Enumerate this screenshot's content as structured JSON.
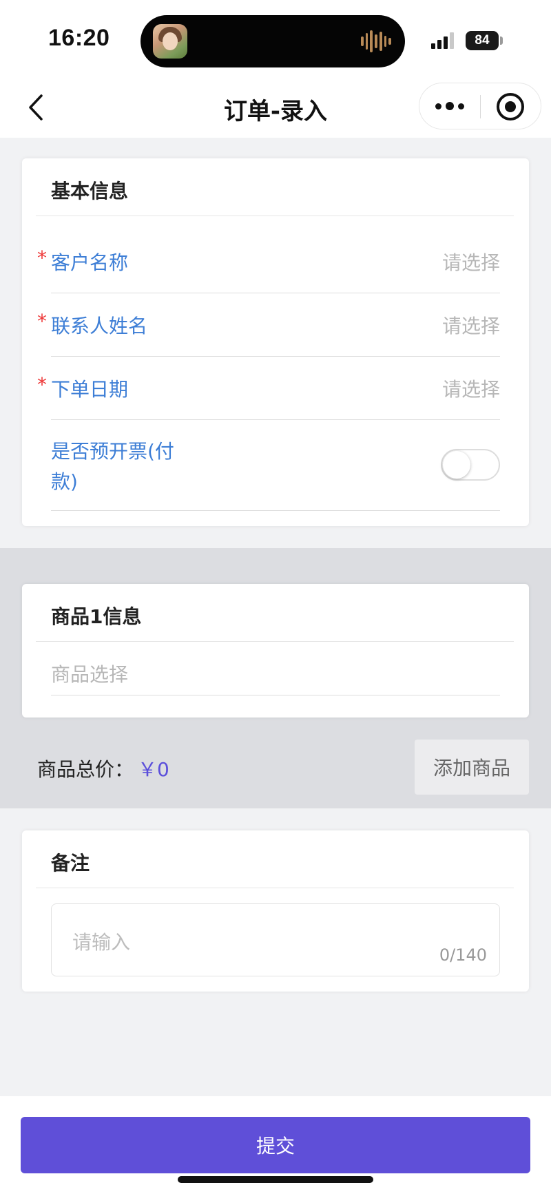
{
  "status_bar": {
    "time": "16:20",
    "battery": "84"
  },
  "nav": {
    "title": "订单-录入",
    "icons": {
      "back": "chevron-left-icon",
      "more": "more-dots-icon",
      "close": "target-circle-icon"
    }
  },
  "basic_info": {
    "title": "基本信息",
    "fields": [
      {
        "label": "客户名称",
        "required": "*",
        "value": "请选择"
      },
      {
        "label": "联系人姓名",
        "required": "*",
        "value": "请选择"
      },
      {
        "label": "下单日期",
        "required": "*",
        "value": "请选择"
      }
    ],
    "invoice": {
      "label": "是否预开票(付款)",
      "label_line1": "是否预开票(付",
      "label_line2": "款)",
      "on": false
    }
  },
  "product": {
    "title": "商品1信息",
    "select_placeholder": "商品选择",
    "total_label": "商品总价：",
    "total_value": "￥0",
    "add_label": "添加商品"
  },
  "remark": {
    "title": "备注",
    "placeholder": "请输入",
    "count": "0/140"
  },
  "submit": {
    "label": "提交"
  },
  "colors": {
    "accent": "#5f4fd8",
    "label_blue": "#3d7ed6",
    "required_red": "#ee3a3a",
    "placeholder_gray": "#b7b7b7",
    "band_gray": "#dcdde1"
  }
}
